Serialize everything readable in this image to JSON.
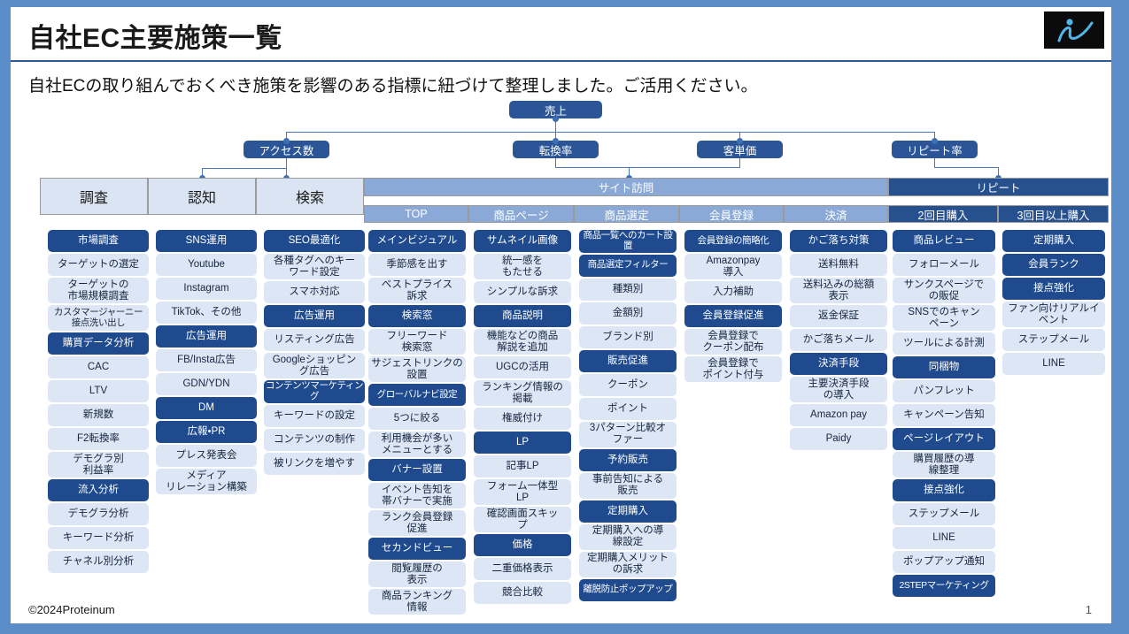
{
  "header": {
    "title": "自社EC主要施策一覧",
    "logo_icon": "proteinum-i-logo"
  },
  "subtitle": "自社ECの取り組んでおくべき施策を影響のある指標に紐づけて整理しました。ご活用ください。",
  "kpi_tree": {
    "root": "売上",
    "level2": [
      "アクセス数",
      "転換率",
      "客単価",
      "リピート率"
    ]
  },
  "grid": {
    "group_headers": [
      {
        "label": "サイト訪問",
        "style": "light"
      },
      {
        "label": "リピート",
        "style": "dark"
      }
    ],
    "stage_headers": [
      "調査",
      "認知",
      "検索"
    ],
    "sub_headers": [
      {
        "label": "TOP",
        "style": "light"
      },
      {
        "label": "商品ページ",
        "style": "light"
      },
      {
        "label": "商品選定",
        "style": "light"
      },
      {
        "label": "会員登録",
        "style": "light"
      },
      {
        "label": "決済",
        "style": "light"
      },
      {
        "label": "2回目購入",
        "style": "dark"
      },
      {
        "label": "3回目以上購入",
        "style": "dark"
      }
    ]
  },
  "columns": [
    {
      "key": "chosa",
      "header": "調査",
      "items": [
        {
          "label": "市場調査",
          "dark": true
        },
        {
          "label": "ターゲットの選定",
          "dark": false
        },
        {
          "label": "ターゲットの\n市場規模調査",
          "dark": false
        },
        {
          "label": "カスタマージャーニー\n接点洗い出し",
          "dark": false,
          "tight": true
        },
        {
          "label": "購買データ分析",
          "dark": true
        },
        {
          "label": "CAC",
          "dark": false
        },
        {
          "label": "LTV",
          "dark": false
        },
        {
          "label": "新規数",
          "dark": false
        },
        {
          "label": "F2転換率",
          "dark": false
        },
        {
          "label": "デモグラ別\n利益率",
          "dark": false
        },
        {
          "label": "流入分析",
          "dark": true
        },
        {
          "label": "デモグラ分析",
          "dark": false
        },
        {
          "label": "キーワード分析",
          "dark": false
        },
        {
          "label": "チャネル別分析",
          "dark": false
        }
      ]
    },
    {
      "key": "ninchi",
      "header": "認知",
      "items": [
        {
          "label": "SNS運用",
          "dark": true
        },
        {
          "label": "Youtube",
          "dark": false
        },
        {
          "label": "Instagram",
          "dark": false
        },
        {
          "label": "TikTok、その他",
          "dark": false
        },
        {
          "label": "広告運用",
          "dark": true
        },
        {
          "label": "FB/Insta広告",
          "dark": false
        },
        {
          "label": "GDN/YDN",
          "dark": false
        },
        {
          "label": "DM",
          "dark": true
        },
        {
          "label": "広報・PR",
          "dark": true
        },
        {
          "label": "プレス発表会",
          "dark": false
        },
        {
          "label": "メディア\nリレーション構築",
          "dark": false
        }
      ]
    },
    {
      "key": "kensaku",
      "header": "検索",
      "items": [
        {
          "label": "SEO最適化",
          "dark": true
        },
        {
          "label": "各種タグへのキー\nワード設定",
          "dark": false
        },
        {
          "label": "スマホ対応",
          "dark": false
        },
        {
          "label": "広告運用",
          "dark": true
        },
        {
          "label": "リスティング広告",
          "dark": false
        },
        {
          "label": "Googleショッピン\nグ広告",
          "dark": false
        },
        {
          "label": "コンテンツマーケティング",
          "dark": true,
          "tight": true
        },
        {
          "label": "キーワードの設定",
          "dark": false
        },
        {
          "label": "コンテンツの制作",
          "dark": false
        },
        {
          "label": "被リンクを増やす",
          "dark": false
        }
      ]
    },
    {
      "key": "top",
      "header": "TOP",
      "items": [
        {
          "label": "メインビジュアル",
          "dark": true
        },
        {
          "label": "季節感を出す",
          "dark": false
        },
        {
          "label": "ベストプライス\n訴求",
          "dark": false
        },
        {
          "label": "検索窓",
          "dark": true
        },
        {
          "label": "フリーワード\n検索窓",
          "dark": false
        },
        {
          "label": "サジェストリンクの\n設置",
          "dark": false
        },
        {
          "label": "グローバルナビ設定",
          "dark": true,
          "tight": true
        },
        {
          "label": "5つに絞る",
          "dark": false
        },
        {
          "label": "利用機会が多い\nメニューとする",
          "dark": false
        },
        {
          "label": "バナー設置",
          "dark": true
        },
        {
          "label": "イベント告知を\n帯バナーで実施",
          "dark": false
        },
        {
          "label": "ランク会員登録\n促進",
          "dark": false
        },
        {
          "label": "セカンドビュー",
          "dark": true
        },
        {
          "label": "閲覧履歴の\n表示",
          "dark": false
        },
        {
          "label": "商品ランキング\n情報",
          "dark": false
        }
      ]
    },
    {
      "key": "shohin_page",
      "header": "商品ページ",
      "items": [
        {
          "label": "サムネイル画像",
          "dark": true
        },
        {
          "label": "統一感を\nもたせる",
          "dark": false
        },
        {
          "label": "シンプルな訴求",
          "dark": false
        },
        {
          "label": "商品説明",
          "dark": true
        },
        {
          "label": "機能などの商品\n解説を追加",
          "dark": false
        },
        {
          "label": "UGCの活用",
          "dark": false
        },
        {
          "label": "ランキング情報の\n掲載",
          "dark": false
        },
        {
          "label": "権威付け",
          "dark": false
        },
        {
          "label": "LP",
          "dark": true
        },
        {
          "label": "記事LP",
          "dark": false
        },
        {
          "label": "フォーム一体型\nLP",
          "dark": false
        },
        {
          "label": "確認画面スキッ\nプ",
          "dark": false
        },
        {
          "label": "価格",
          "dark": true
        },
        {
          "label": "二重価格表示",
          "dark": false
        },
        {
          "label": "競合比較",
          "dark": false
        }
      ]
    },
    {
      "key": "shohin_sentei",
      "header": "商品選定",
      "items": [
        {
          "label": "商品一覧へのカート設置",
          "dark": true,
          "tight": true
        },
        {
          "label": "商品選定フィルター",
          "dark": true,
          "tight": true
        },
        {
          "label": "種類別",
          "dark": false
        },
        {
          "label": "金額別",
          "dark": false
        },
        {
          "label": "ブランド別",
          "dark": false
        },
        {
          "label": "販売促進",
          "dark": true
        },
        {
          "label": "クーポン",
          "dark": false
        },
        {
          "label": "ポイント",
          "dark": false
        },
        {
          "label": "3パターン比較オ\nファー",
          "dark": false
        },
        {
          "label": "予約販売",
          "dark": true
        },
        {
          "label": "事前告知による\n販売",
          "dark": false
        },
        {
          "label": "定期購入",
          "dark": true
        },
        {
          "label": "定期購入への導\n線設定",
          "dark": false
        },
        {
          "label": "定期購入メリット\nの訴求",
          "dark": false
        },
        {
          "label": "離脱防止ポップアップ",
          "dark": true,
          "tight": true
        }
      ]
    },
    {
      "key": "kaiin_toroku",
      "header": "会員登録",
      "items": [
        {
          "label": "会員登録の簡略化",
          "dark": true,
          "tight": true
        },
        {
          "label": "Amazonpay\n導入",
          "dark": false
        },
        {
          "label": "入力補助",
          "dark": false
        },
        {
          "label": "会員登録促進",
          "dark": true
        },
        {
          "label": "会員登録で\nクーポン配布",
          "dark": false
        },
        {
          "label": "会員登録で\nポイント付与",
          "dark": false
        }
      ]
    },
    {
      "key": "kessai",
      "header": "決済",
      "items": [
        {
          "label": "かご落ち対策",
          "dark": true
        },
        {
          "label": "送料無料",
          "dark": false
        },
        {
          "label": "送料込みの総額\n表示",
          "dark": false
        },
        {
          "label": "返金保証",
          "dark": false
        },
        {
          "label": "かご落ちメール",
          "dark": false
        },
        {
          "label": "決済手段",
          "dark": true
        },
        {
          "label": "主要決済手段\nの導入",
          "dark": false
        },
        {
          "label": "Amazon pay",
          "dark": false
        },
        {
          "label": "Paidy",
          "dark": false
        }
      ]
    },
    {
      "key": "nikaime",
      "header": "2回目購入",
      "items": [
        {
          "label": "商品レビュー",
          "dark": true
        },
        {
          "label": "フォローメール",
          "dark": false
        },
        {
          "label": "サンクスページで\nの販促",
          "dark": false
        },
        {
          "label": "SNSでのキャン\nペーン",
          "dark": false
        },
        {
          "label": "ツールによる計測",
          "dark": false
        },
        {
          "label": "同梱物",
          "dark": true
        },
        {
          "label": "パンフレット",
          "dark": false
        },
        {
          "label": "キャンペーン告知",
          "dark": false
        },
        {
          "label": "ページレイアウト",
          "dark": true
        },
        {
          "label": "購買履歴の導\n線整理",
          "dark": false
        },
        {
          "label": "接点強化",
          "dark": true
        },
        {
          "label": "ステップメール",
          "dark": false
        },
        {
          "label": "LINE",
          "dark": false
        },
        {
          "label": "ポップアップ通知",
          "dark": false
        },
        {
          "label": "2STEPマーケティング",
          "dark": true,
          "tight": true
        }
      ]
    },
    {
      "key": "sankaime",
      "header": "3回目以上購入",
      "items": [
        {
          "label": "定期購入",
          "dark": true
        },
        {
          "label": "会員ランク",
          "dark": true
        },
        {
          "label": "接点強化",
          "dark": true
        },
        {
          "label": "ファン向けリアルイ\nベント",
          "dark": false
        },
        {
          "label": "ステップメール",
          "dark": false
        },
        {
          "label": "LINE",
          "dark": false
        }
      ]
    }
  ],
  "footer": {
    "copyright": "©2024Proteinum",
    "page_number": "1"
  },
  "colors": {
    "dark_card": "#1f4b8e",
    "light_card": "#dce6f5",
    "header_light": "#8aa9d6",
    "header_dark": "#27508f",
    "stage_header": "#dbe4f2",
    "slide_background": "#5b8ec9",
    "kpi_node": "#2b5597"
  }
}
